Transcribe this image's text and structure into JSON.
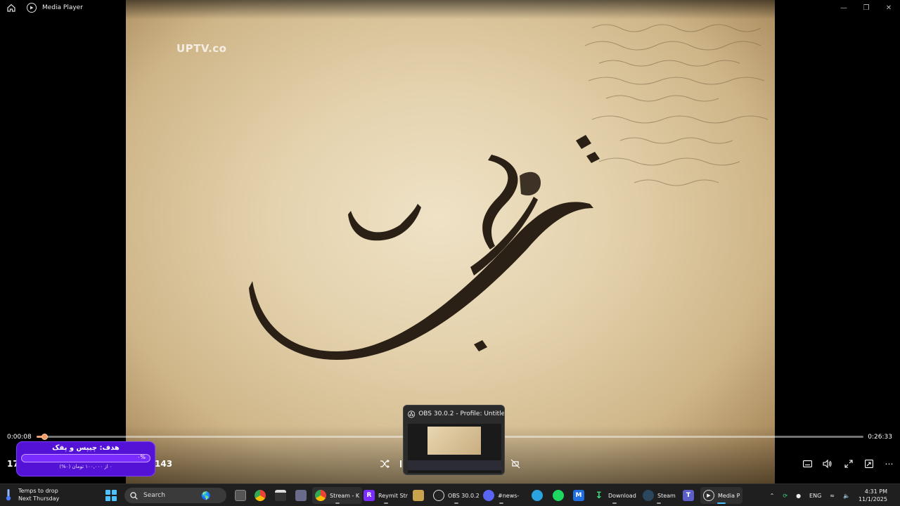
{
  "window": {
    "title": "Media Player"
  },
  "video": {
    "watermark": "UPTV.co"
  },
  "playback": {
    "current_time": "0:00:08",
    "total_time": "0:26:33",
    "progress_fraction": 0.009
  },
  "overlay": {
    "left_number": "17",
    "right_number": "143"
  },
  "donation_goal": {
    "title": "هدف: چیپس و پفک",
    "percent_label": "٠%",
    "subtitle": "٠ از ١٠٠,٠٠٠ تومان (٠%)",
    "progress_fraction": 0.0
  },
  "obs_preview": {
    "title": "OBS 30.0.2 - Profile: Untitle..."
  },
  "taskbar": {
    "weather_line1": "Temps to drop",
    "weather_line2": "Next Thursday",
    "search_placeholder": "Search",
    "apps": [
      {
        "label": "Stream - K",
        "icon": "chrome-icon"
      },
      {
        "label": "Reymit Str",
        "icon": "reymit-icon"
      },
      {
        "label": "OBS 30.0.2",
        "icon": "obs-icon"
      },
      {
        "label": "#news-",
        "icon": "discord-icon"
      },
      {
        "label": "Download",
        "icon": "download-icon"
      },
      {
        "label": "Steam",
        "icon": "steam-icon"
      },
      {
        "label": "Media P",
        "icon": "media-player-icon"
      }
    ],
    "language": "ENG",
    "time": "4:31 PM",
    "date": "11/1/2025"
  },
  "colors": {
    "accent": "#f29b62",
    "goal_purple": "#5312d6",
    "windows_blue": "#4cc2ff"
  }
}
